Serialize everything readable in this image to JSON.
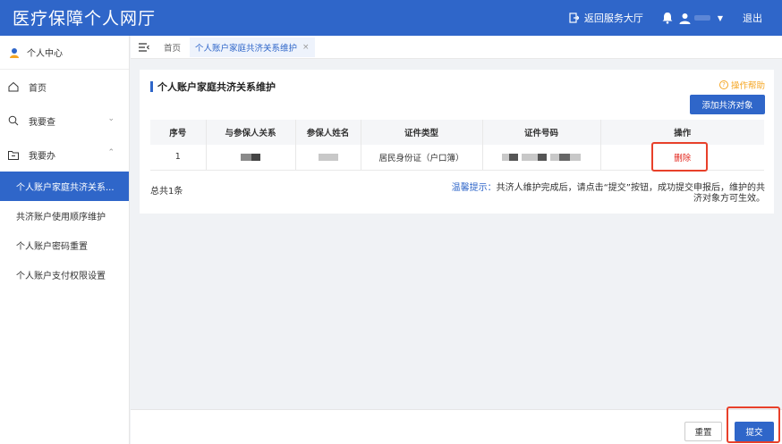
{
  "header": {
    "brand": "医疗保障个人网厅",
    "back_label": "返回服务大厅",
    "logout_label": "退出",
    "bg_color": "#2f66c9"
  },
  "sidebar": {
    "profile_label": "个人中心",
    "home_label": "首页",
    "query_label": "我要查",
    "do_label": "我要办",
    "sub_items": [
      {
        "label": "个人账户家庭共济关系..."
      },
      {
        "label": "共济账户使用顺序维护"
      },
      {
        "label": "个人账户密码重置"
      },
      {
        "label": "个人账户支付权限设置"
      }
    ]
  },
  "tabs": {
    "home": "首页",
    "active": "个人账户家庭共济关系维护",
    "close": "×"
  },
  "card": {
    "title": "个人账户家庭共济关系维护",
    "help_label": "操作帮助",
    "add_button": "添加共济对象",
    "columns": [
      "序号",
      "与参保人关系",
      "参保人姓名",
      "证件类型",
      "证件号码",
      "操作"
    ],
    "rows": [
      {
        "index": "1",
        "id_type": "居民身份证（户口簿）",
        "action": "删除"
      }
    ],
    "total": "总共1条",
    "tip_label": "温馨提示：",
    "tip_text": "共济人维护完成后，请点击“提交”按钮，成功提交申报后，维护的共济对象方可生效。"
  },
  "footer": {
    "reset_label": "重置",
    "submit_label": "提交"
  }
}
